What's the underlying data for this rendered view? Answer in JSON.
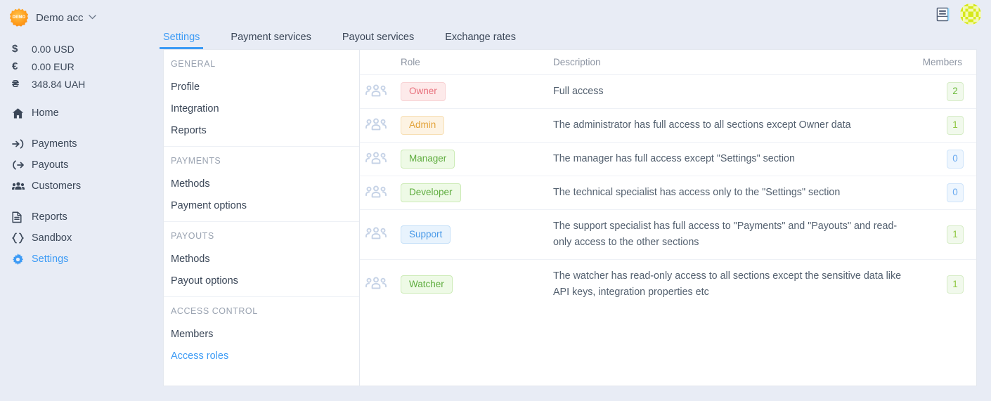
{
  "sidebar": {
    "brand": {
      "logo_text": "DEMO",
      "name": "Demo acc",
      "caret": "⌄"
    },
    "balances": [
      {
        "symbol": "$",
        "amount": "0.00 USD"
      },
      {
        "symbol": "€",
        "amount": "0.00 EUR"
      },
      {
        "symbol": "₴",
        "amount": "348.84 UAH"
      }
    ],
    "nav_groups": [
      [
        {
          "icon": "home-icon",
          "label": "Home",
          "active": false
        }
      ],
      [
        {
          "icon": "payments-icon",
          "label": "Payments",
          "active": false
        },
        {
          "icon": "payouts-icon",
          "label": "Payouts",
          "active": false
        },
        {
          "icon": "customers-icon",
          "label": "Customers",
          "active": false
        }
      ],
      [
        {
          "icon": "reports-icon",
          "label": "Reports",
          "active": false
        },
        {
          "icon": "sandbox-icon",
          "label": "Sandbox",
          "active": false
        },
        {
          "icon": "settings-gear-icon",
          "label": "Settings",
          "active": true
        }
      ]
    ]
  },
  "topbar": {
    "docs_icon": "book-icon",
    "avatar": "user-avatar-identicon"
  },
  "tabs": [
    {
      "label": "Settings",
      "active": true
    },
    {
      "label": "Payment services",
      "active": false
    },
    {
      "label": "Payout services",
      "active": false
    },
    {
      "label": "Exchange rates",
      "active": false
    }
  ],
  "submenu": [
    {
      "title": "GENERAL",
      "links": [
        {
          "label": "Profile",
          "active": false
        },
        {
          "label": "Integration",
          "active": false
        },
        {
          "label": "Reports",
          "active": false
        }
      ]
    },
    {
      "title": "PAYMENTS",
      "links": [
        {
          "label": "Methods",
          "active": false
        },
        {
          "label": "Payment options",
          "active": false
        }
      ]
    },
    {
      "title": "PAYOUTS",
      "links": [
        {
          "label": "Methods",
          "active": false
        },
        {
          "label": "Payout options",
          "active": false
        }
      ]
    },
    {
      "title": "ACCESS CONTROL",
      "links": [
        {
          "label": "Members",
          "active": false
        },
        {
          "label": "Access roles",
          "active": true
        }
      ]
    }
  ],
  "table": {
    "headers": {
      "role": "Role",
      "description": "Description",
      "members": "Members"
    },
    "rows": [
      {
        "icon": "group-icon",
        "role": "Owner",
        "description": "Full access",
        "members": "2",
        "badge_bg": "#fdeaea",
        "badge_border": "#f8d2d4",
        "badge_color": "#e8707c",
        "count_bg": "#f1f9ec",
        "count_border": "#d6ecc6",
        "count_color": "#6cbb3c"
      },
      {
        "icon": "group-icon",
        "role": "Admin",
        "description": "The administrator has full access to all sections except Owner data",
        "members": "1",
        "badge_bg": "#fdf3e3",
        "badge_border": "#f7dfb4",
        "badge_color": "#e2a33a",
        "count_bg": "#f1f9ec",
        "count_border": "#d6ecc6",
        "count_color": "#8dc63f"
      },
      {
        "icon": "group-icon",
        "role": "Manager",
        "description": "The manager has full access except \"Settings\" section",
        "members": "0",
        "badge_bg": "#eefae6",
        "badge_border": "#ccebb6",
        "badge_color": "#5fad3f",
        "count_bg": "#eef6fe",
        "count_border": "#cfe4fa",
        "count_color": "#6aaaf0"
      },
      {
        "icon": "group-icon",
        "role": "Developer",
        "description": "The technical specialist has access only to the \"Settings\" section",
        "members": "0",
        "badge_bg": "#eefae6",
        "badge_border": "#ccebb6",
        "badge_color": "#5fad3f",
        "count_bg": "#eef6fe",
        "count_border": "#cfe4fa",
        "count_color": "#6aaaf0"
      },
      {
        "icon": "group-icon",
        "role": "Support",
        "description": "The support specialist has full access to \"Payments\" and \"Payouts\" and read-only access to the other sections",
        "members": "1",
        "badge_bg": "#e8f3fd",
        "badge_border": "#c5e0f8",
        "badge_color": "#4a9ae8",
        "count_bg": "#f1f9ec",
        "count_border": "#d6ecc6",
        "count_color": "#8dc63f"
      },
      {
        "icon": "group-icon",
        "role": "Watcher",
        "description": "The watcher has read-only access to all sections except the sensitive data like API keys, integration properties etc",
        "members": "1",
        "badge_bg": "#eefae6",
        "badge_border": "#ccebb6",
        "badge_color": "#5fad3f",
        "count_bg": "#f1f9ec",
        "count_border": "#d6ecc6",
        "count_color": "#8dc63f"
      }
    ]
  },
  "colors": {
    "accent": "#3d9bf5",
    "page_bg": "#e8ecf5",
    "panel_bg": "#ffffff",
    "text": "#3b4758"
  }
}
